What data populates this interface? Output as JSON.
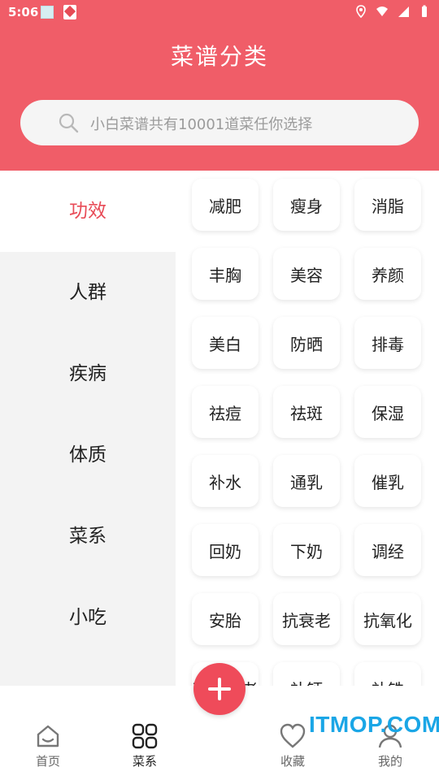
{
  "status_bar": {
    "time": "5:06"
  },
  "header": {
    "title": "菜谱分类"
  },
  "search": {
    "placeholder": "小白菜谱共有10001道菜任你选择"
  },
  "sidebar": {
    "items": [
      {
        "label": "功效",
        "active": true
      },
      {
        "label": "人群",
        "active": false
      },
      {
        "label": "疾病",
        "active": false
      },
      {
        "label": "体质",
        "active": false
      },
      {
        "label": "菜系",
        "active": false
      },
      {
        "label": "小吃",
        "active": false
      }
    ]
  },
  "grid": {
    "tags": [
      [
        "减肥",
        "瘦身",
        "消脂"
      ],
      [
        "丰胸",
        "美容",
        "养颜"
      ],
      [
        "美白",
        "防晒",
        "排毒"
      ],
      [
        "祛痘",
        "祛斑",
        "保湿"
      ],
      [
        "补水",
        "通乳",
        "催乳"
      ],
      [
        "回奶",
        "下奶",
        "调经"
      ],
      [
        "安胎",
        "抗衰老",
        "抗氧化"
      ],
      [
        "延缓衰老",
        "补钙",
        "补铁"
      ]
    ]
  },
  "bottom_nav": {
    "items": [
      {
        "label": "首页",
        "icon": "home-icon"
      },
      {
        "label": "菜系",
        "icon": "grid-icon",
        "active": true
      },
      {
        "label": "收藏",
        "icon": "heart-icon"
      },
      {
        "label": "我的",
        "icon": "user-icon"
      }
    ],
    "fab_icon": "plus-icon"
  },
  "watermark": "ITMOP.COM",
  "colors": {
    "accent": "#f05d68",
    "active_text": "#e84b57",
    "fab": "#ef4b5a"
  }
}
